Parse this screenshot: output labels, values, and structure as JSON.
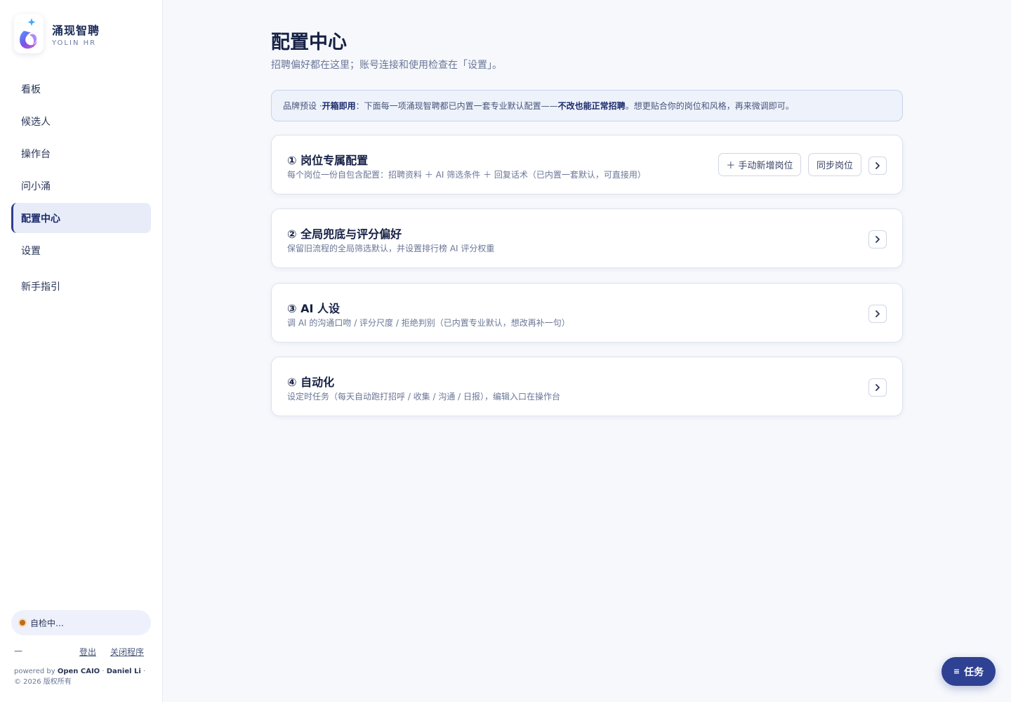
{
  "brand": {
    "name": "涌现智聘",
    "sub": "YOLIN HR"
  },
  "nav": {
    "items": [
      {
        "label": "看板"
      },
      {
        "label": "候选人"
      },
      {
        "label": "操作台"
      },
      {
        "label": "问小涌"
      },
      {
        "label": "配置中心"
      },
      {
        "label": "设置"
      }
    ],
    "guide": "新手指引",
    "active": "配置中心"
  },
  "status": {
    "label": "自检中…",
    "color": "#c26a14"
  },
  "footer": {
    "dash": "—",
    "logout": "登出",
    "close": "关闭程序",
    "powered_prefix": "powered by",
    "powered_org": "Open CAIO",
    "powered_sep": "·",
    "powered_person": "Daniel Li",
    "copyright": "© 2026 版权所有"
  },
  "page": {
    "title": "配置中心",
    "subtitle": "招聘偏好都在这里；账号连接和使用检查在「设置」。"
  },
  "notice": {
    "prefix": "品牌预设 · ",
    "strong1": "开箱即用",
    "middle": "：下面每一项涌现智聘都已内置一套专业默认配置——",
    "strong2": "不改也能正常招聘",
    "suffix": "。想更贴合你的岗位和风格，再来微调即可。"
  },
  "cards": [
    {
      "title": "① 岗位专属配置",
      "desc": "每个岗位一份自包含配置：招聘资料 ＋ AI 筛选条件 ＋ 回复话术（已内置一套默认，可直接用）",
      "add_button": "＋ 手动新增岗位",
      "sync_button": "同步岗位"
    },
    {
      "title": "② 全局兜底与评分偏好",
      "desc": "保留旧流程的全局筛选默认，并设置排行榜 AI 评分权重"
    },
    {
      "title": "③ AI 人设",
      "desc": "调 AI 的沟通口吻 / 评分尺度 / 拒绝判别（已内置专业默认，想改再补一句）"
    },
    {
      "title": "④ 自动化",
      "desc": "设定时任务（每天自动跑打招呼 / 收集 / 沟通 / 日报），编辑入口在操作台"
    }
  ],
  "tasks_button": {
    "icon": "≡",
    "label": "任务"
  },
  "colors": {
    "accent": "#2e4192",
    "active_bg": "#e8ecf9",
    "page_bg": "#f6f8fc"
  }
}
